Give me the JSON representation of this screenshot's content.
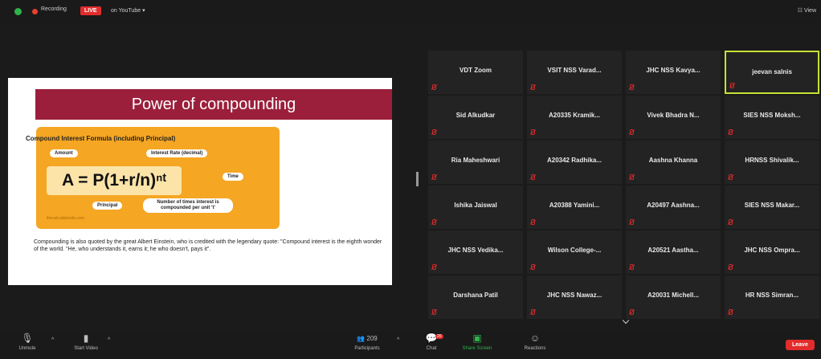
{
  "topbar": {
    "recording": "Recording",
    "live": "LIVE",
    "platform": "on YouTube",
    "view": "View"
  },
  "slide": {
    "title": "Power of compounding",
    "formula_title": "Compound Interest Formula (including Principal)",
    "labels": {
      "amount": "Amount",
      "rate": "Interest Rate (decimal)",
      "time": "Time",
      "principal": "Principal",
      "times": "Number of times interest is compounded per unit 't'"
    },
    "formula": "A = P(1+r/n)ⁿᵗ",
    "source": "thecalculatorsite.com",
    "quote": "Compounding is also quoted by the great Albert Einstein, who is credited with the legendary quote: \"Compound interest is the eighth wonder of the world. \"He, who understands it, earns it; he who doesn't, pays it\"."
  },
  "participants": [
    "VDT Zoom",
    "VSIT NSS Varad...",
    "JHC NSS Kavya...",
    "jeevan salnis",
    "Sid Alkudkar",
    "A20335 Kramik...",
    "Vivek Bhadra N...",
    "SIES NSS Moksh...",
    "Ria Maheshwari",
    "A20342 Radhika...",
    "Aashna Khanna",
    "HRNSS Shivalik...",
    "Ishika Jaiswal",
    "A20388 Yamini...",
    "A20497 Aashna...",
    "SIES NSS Makar...",
    "JHC NSS Vedika...",
    "Wilson College-...",
    "A20521 Aastha...",
    "JHC NSS Ompra...",
    "Darshana Patil",
    "JHC NSS Nawaz...",
    "A20031 Michell...",
    "HR NSS Simran..."
  ],
  "active_speaker": "jeevan salnis",
  "toolbar": {
    "unmute": "Unmute",
    "start_video": "Start Video",
    "participants": "Participants",
    "participant_count": "209",
    "chat": "Chat",
    "chat_badge": "20",
    "share_screen": "Share Screen",
    "reactions": "Reactions",
    "leave": "Leave"
  },
  "colors": {
    "banner": "#9b1f3b",
    "formula_box": "#f5a623",
    "live": "#e22c2c",
    "share_green": "#2fb34a",
    "active_border": "#c8e034"
  }
}
